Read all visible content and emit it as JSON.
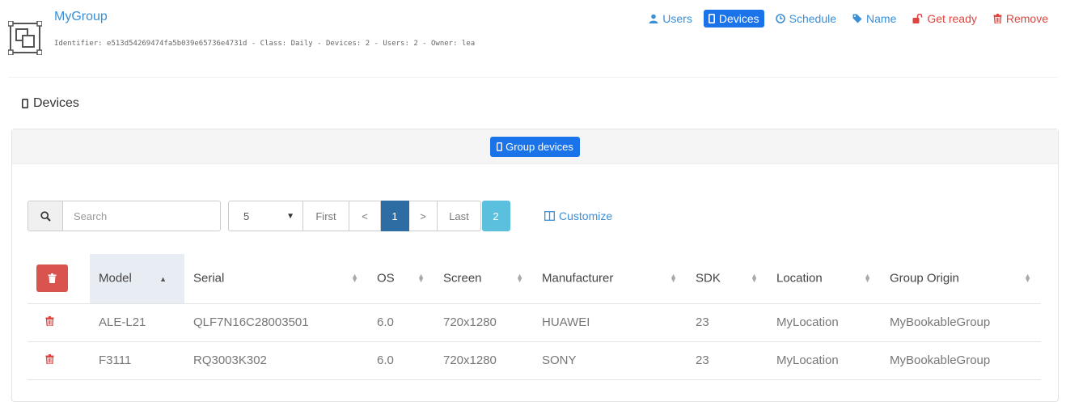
{
  "header": {
    "title": "MyGroup",
    "meta": "Identifier: e513d54269474fa5b039e65736e4731d - Class: Daily - Devices: 2 - Users: 2 - Owner: lea",
    "actions": [
      {
        "label": "Users",
        "icon": "user-icon"
      },
      {
        "label": "Devices",
        "icon": "mobile-icon",
        "active": true
      },
      {
        "label": "Schedule",
        "icon": "clock-icon"
      },
      {
        "label": "Name",
        "icon": "tag-icon"
      },
      {
        "label": "Get ready",
        "icon": "unlock-icon"
      },
      {
        "label": "Remove",
        "icon": "trash-icon"
      }
    ]
  },
  "section": {
    "title": "Devices",
    "group_devices_label": "Group devices"
  },
  "toolbar": {
    "search_placeholder": "Search",
    "page_size": "5",
    "first_label": "First",
    "prev_label": "<",
    "current_page": "1",
    "next_label": ">",
    "last_label": "Last",
    "total_pages": "2",
    "customize_label": "Customize"
  },
  "table": {
    "columns": [
      "Model",
      "Serial",
      "OS",
      "Screen",
      "Manufacturer",
      "SDK",
      "Location",
      "Group Origin"
    ],
    "rows": [
      {
        "model": "ALE-L21",
        "serial": "QLF7N16C28003501",
        "os": "6.0",
        "screen": "720x1280",
        "manufacturer": "HUAWEI",
        "sdk": "23",
        "location": "MyLocation",
        "origin": "MyBookableGroup"
      },
      {
        "model": "F3111",
        "serial": "RQ3003K302",
        "os": "6.0",
        "screen": "720x1280",
        "manufacturer": "SONY",
        "sdk": "23",
        "location": "MyLocation",
        "origin": "MyBookableGroup"
      }
    ]
  },
  "colors": {
    "link": "#3a8fd6",
    "active": "#1a73e8",
    "danger": "#e0443e",
    "pager_current": "#2e6da4",
    "pager_total": "#5bc0de"
  }
}
